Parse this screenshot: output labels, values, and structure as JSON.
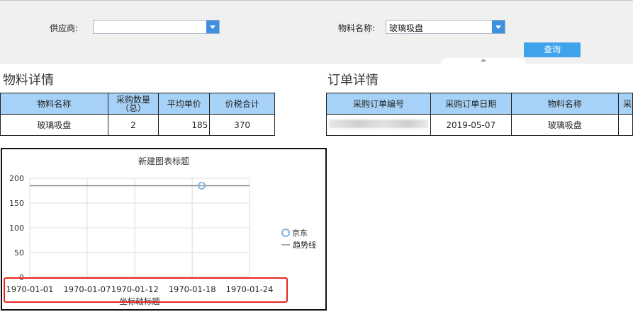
{
  "filters": {
    "supplier_label": "供应商:",
    "supplier_value": "",
    "material_label": "物料名称:",
    "material_value": "玻璃吸盘",
    "query_button": "查询"
  },
  "material_detail": {
    "title": "物料详情",
    "columns": [
      "物料名称",
      "采购数量\n（总）",
      "平均单价",
      "价税合计"
    ],
    "rows": [
      [
        "玻璃吸盘",
        "2",
        "185",
        "370"
      ]
    ]
  },
  "order_detail": {
    "title": "订单详情",
    "columns": [
      "采购订单编号",
      "采购订单日期",
      "物料名称",
      "采"
    ],
    "rows": [
      [
        "",
        "2019-05-07",
        "玻璃吸盘",
        ""
      ]
    ]
  },
  "chart_data": {
    "type": "line",
    "title": "新建图表标题",
    "xlabel": "坐标轴标题",
    "ylabel": "",
    "x_ticks": [
      "1970-01-01",
      "1970-01-07",
      "1970-01-12",
      "1970-01-18",
      "1970-01-24"
    ],
    "y_ticks": [
      "0",
      "50",
      "100",
      "150",
      "200"
    ],
    "ylim": [
      0,
      200
    ],
    "grid": true,
    "legend_position": "right",
    "series": [
      {
        "name": "京东",
        "kind": "scatter",
        "points": [
          {
            "x": "1970-01-19",
            "y": 185
          }
        ],
        "color": "#7fb2e5"
      },
      {
        "name": "趋势线",
        "kind": "line",
        "values": [
          185,
          185
        ],
        "color": "#8a8a8a"
      }
    ]
  }
}
